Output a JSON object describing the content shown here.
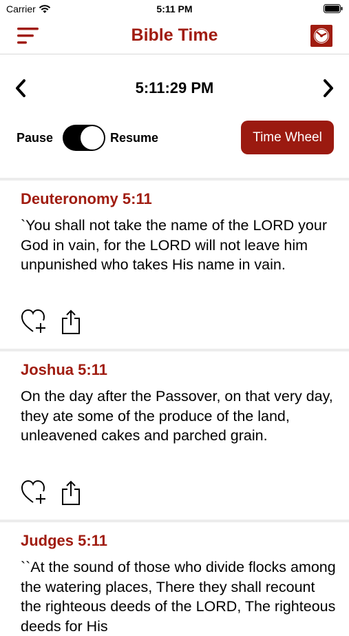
{
  "status": {
    "carrier": "Carrier",
    "time": "5:11 PM"
  },
  "header": {
    "title": "Bible Time"
  },
  "clock": {
    "time": "5:11:29 PM"
  },
  "controls": {
    "pause_label": "Pause",
    "resume_label": "Resume",
    "time_wheel_label": "Time Wheel",
    "toggle_on": true
  },
  "verses": [
    {
      "reference": "Deuteronomy 5:11",
      "text": "`You shall not take the name of the LORD your God in vain, for the LORD will not leave him unpunished who takes His name in vain."
    },
    {
      "reference": "Joshua 5:11",
      "text": "On the day after the Passover, on that very day, they ate some of the produce of the land, unleavened cakes and parched grain."
    },
    {
      "reference": "Judges 5:11",
      "text": "``At the sound of those who divide flocks among the watering places, There they shall recount the righteous deeds of the LORD, The righteous deeds for His"
    }
  ],
  "colors": {
    "accent": "#a01c10",
    "button": "#9b1a10"
  }
}
